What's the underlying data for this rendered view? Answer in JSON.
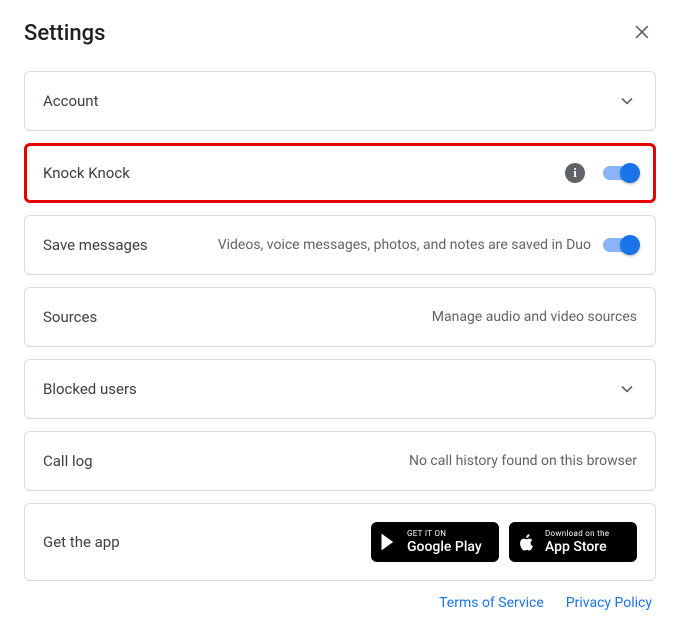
{
  "header": {
    "title": "Settings"
  },
  "rows": {
    "account": {
      "title": "Account"
    },
    "knock": {
      "title": "Knock Knock"
    },
    "save": {
      "title": "Save messages",
      "desc": "Videos, voice messages, photos, and notes are saved in Duo"
    },
    "sources": {
      "title": "Sources",
      "desc": "Manage audio and video sources"
    },
    "blocked": {
      "title": "Blocked users"
    },
    "calllog": {
      "title": "Call log",
      "desc": "No call history found on this browser"
    },
    "getapp": {
      "title": "Get the app"
    }
  },
  "store": {
    "play": {
      "small": "GET IT ON",
      "big": "Google Play"
    },
    "apple": {
      "small": "Download on the",
      "big": "App Store"
    }
  },
  "footer": {
    "tos": "Terms of Service",
    "privacy": "Privacy Policy"
  }
}
